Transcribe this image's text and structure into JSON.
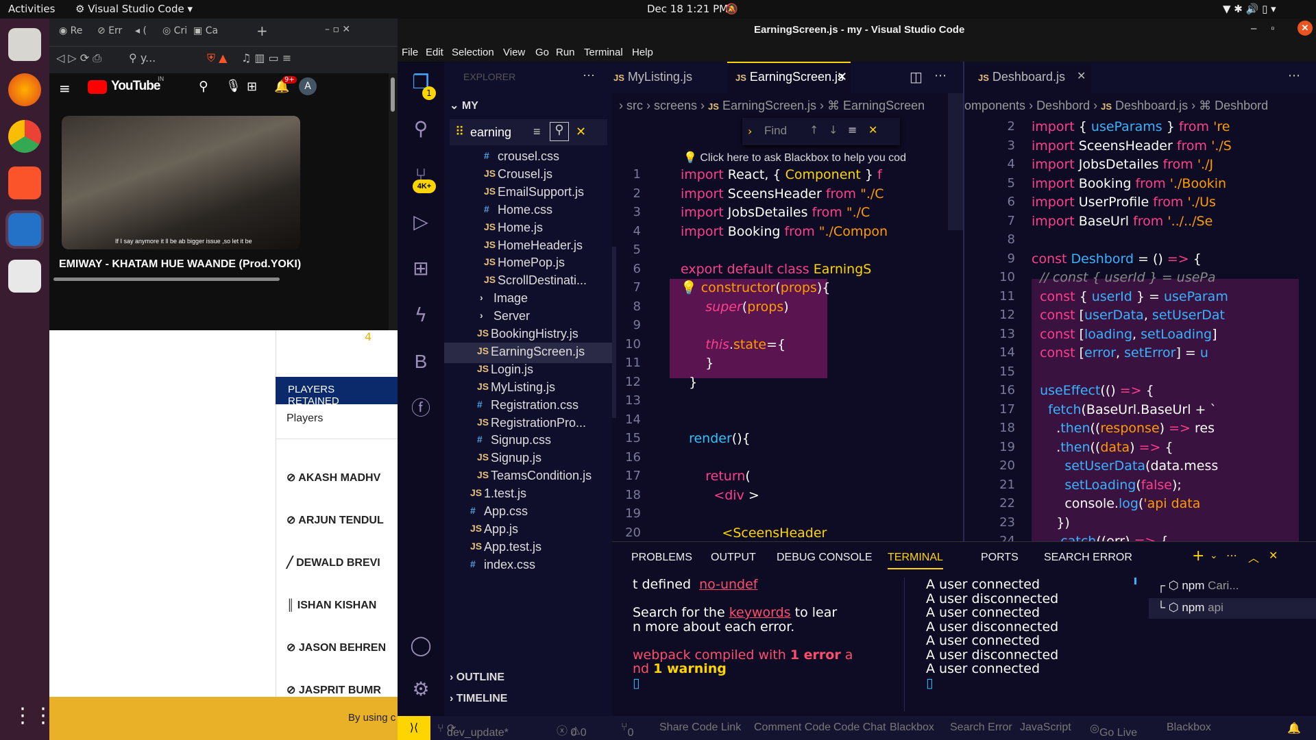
{
  "topbar": {
    "activities": "Activities",
    "app": "Visual Studio Code",
    "datetime": "Dec 18  1:21 PM"
  },
  "browser": {
    "tabs": [
      "Re",
      "Err",
      "(",
      "Cri",
      "Ca"
    ],
    "url": "y...",
    "youtube": {
      "logo": "YouTube",
      "region": "IN",
      "notif": "9+",
      "avatar": "A",
      "caption": "If I say anymore it ll be  ab bigger issue ,so let it be",
      "video_title": "EMIWAY - KHATAM HUE WAANDE (Prod.YOKI)"
    },
    "page": {
      "number": "4",
      "section": "PLAYERS RETAINED",
      "col": "Players",
      "players": [
        "AKASH MADHV",
        "ARJUN TENDUL",
        "DEWALD BREVI",
        "ISHAN KISHAN",
        "JASON BEHREN",
        "JASPRIT BUMR"
      ],
      "cookie": "By using c"
    }
  },
  "vscode": {
    "title": "EarningScreen.js - my - Visual Studio Code",
    "menu": [
      "File",
      "Edit",
      "Selection",
      "View",
      "Go",
      "Run",
      "Terminal",
      "Help"
    ],
    "badges": {
      "explorer": "1",
      "scm": "4K+"
    },
    "sidebar": {
      "header": "EXPLORER",
      "root": "MY",
      "search": "earning",
      "files": [
        {
          "type": "css",
          "name": "crousel.css"
        },
        {
          "type": "js",
          "name": "Crousel.js"
        },
        {
          "type": "js",
          "name": "EmailSupport.js"
        },
        {
          "type": "css",
          "name": "Home.css"
        },
        {
          "type": "js",
          "name": "Home.js"
        },
        {
          "type": "js",
          "name": "HomeHeader.js"
        },
        {
          "type": "js",
          "name": "HomePop.js"
        },
        {
          "type": "js",
          "name": "ScrollDestinati..."
        },
        {
          "type": "folder",
          "name": "Image"
        },
        {
          "type": "folder",
          "name": "Server"
        },
        {
          "type": "js",
          "name": "BookingHistry.js"
        },
        {
          "type": "js",
          "name": "EarningScreen.js"
        },
        {
          "type": "js",
          "name": "Login.js"
        },
        {
          "type": "js",
          "name": "MyListing.js"
        },
        {
          "type": "css",
          "name": "Registration.css"
        },
        {
          "type": "js",
          "name": "RegistrationPro..."
        },
        {
          "type": "css",
          "name": "Signup.css"
        },
        {
          "type": "js",
          "name": "Signup.js"
        },
        {
          "type": "js",
          "name": "TeamsCondition.js"
        },
        {
          "type": "js",
          "name": "1.test.js"
        },
        {
          "type": "css",
          "name": "App.css"
        },
        {
          "type": "js",
          "name": "App.js"
        },
        {
          "type": "js",
          "name": "App.test.js"
        },
        {
          "type": "css",
          "name": "index.css"
        }
      ],
      "outline": "OUTLINE",
      "timeline": "TIMELINE"
    },
    "editor1": {
      "tabs": [
        "MyListing.js",
        "EarningScreen.js"
      ],
      "breadcrumb": [
        "src",
        "screens",
        "EarningScreen.js",
        "EarningScreen"
      ],
      "find": "Find",
      "hint": "Click here to ask Blackbox to help you cod",
      "lines": [
        "1",
        "2",
        "3",
        "4",
        "5",
        "6",
        "7",
        "8",
        "9",
        "10",
        "11",
        "12",
        "13",
        "14",
        "15",
        "16",
        "17",
        "18",
        "19",
        "20"
      ]
    },
    "editor2": {
      "tab": "Deshboard.js",
      "breadcrumb": [
        "omponents",
        "Deshbord",
        "Deshboard.js",
        "Deshbord"
      ],
      "lines": [
        "2",
        "3",
        "4",
        "5",
        "6",
        "7",
        "8",
        "9",
        "10",
        "11",
        "12",
        "13",
        "14",
        "15",
        "16",
        "17",
        "18",
        "19",
        "20",
        "21",
        "22",
        "23",
        "24"
      ]
    },
    "panel": {
      "tabs": [
        "PROBLEMS",
        "OUTPUT",
        "DEBUG CONSOLE",
        "TERMINAL",
        "PORTS",
        "SEARCH ERROR"
      ],
      "left": [
        "t defined",
        "no-undef",
        "Search for the",
        "keywords",
        "to lear",
        "n more about each error.",
        "webpack compiled with",
        "1 error",
        "a",
        "nd",
        "1 warning"
      ],
      "right": [
        "A user connected",
        "A user disconnected",
        "A user connected",
        "A user disconnected",
        "A user connected",
        "A user disconnected",
        "A user connected"
      ],
      "terms": [
        {
          "name": "npm",
          "sub": "Cari..."
        },
        {
          "name": "npm",
          "sub": "api"
        }
      ]
    },
    "status": [
      "dev_update*",
      "0",
      "0",
      "0",
      "Share Code Link",
      "Comment Code",
      "Code Chat",
      "Blackbox",
      "Search Error",
      "JavaScript",
      "Go Live",
      "Blackbox"
    ]
  }
}
